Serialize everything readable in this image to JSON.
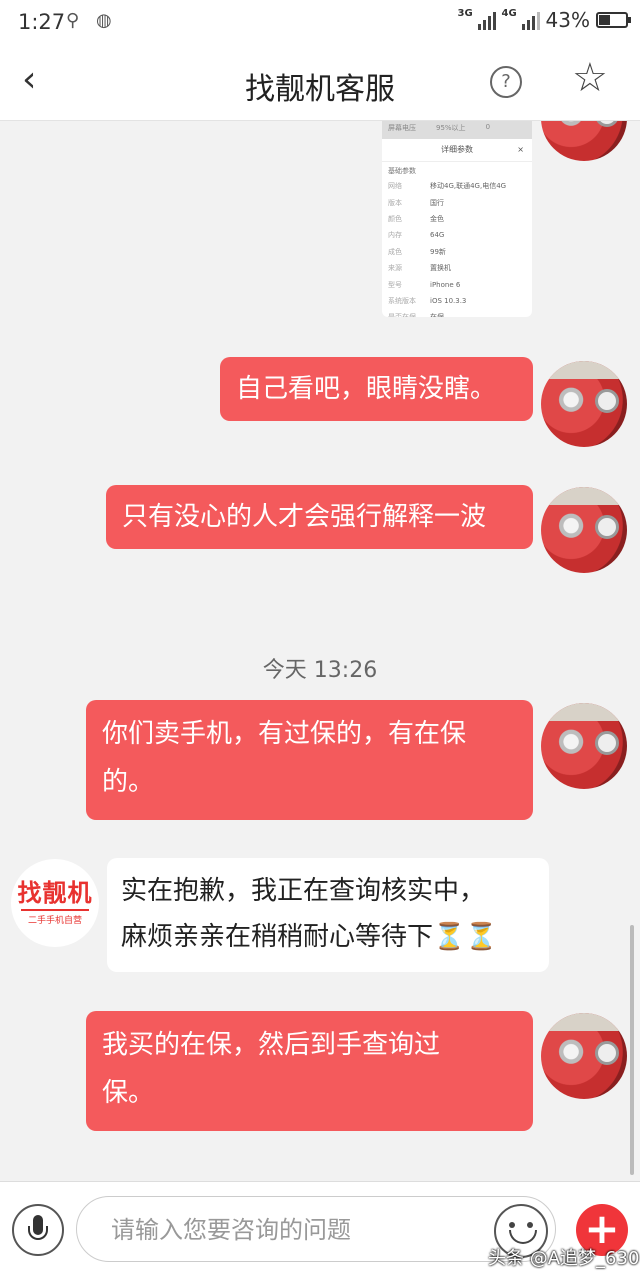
{
  "status": {
    "time": "1:27",
    "battery": "43%",
    "battery_level": 0.43,
    "net1": "3G",
    "net2": "4G"
  },
  "header": {
    "title": "找靓机客服",
    "help_icon": "?",
    "back_icon": "‹",
    "star_icon": "☆"
  },
  "screenshot": {
    "top_left": "屏幕电压",
    "top_right": "95%以上",
    "top_val": "0",
    "title": "详细参数",
    "section": "基础参数",
    "rows": [
      {
        "k": "网络",
        "v": "移动4G,联通4G,电信4G"
      },
      {
        "k": "版本",
        "v": "国行"
      },
      {
        "k": "颜色",
        "v": "金色"
      },
      {
        "k": "内存",
        "v": "64G"
      },
      {
        "k": "成色",
        "v": "99新"
      },
      {
        "k": "来源",
        "v": "置换机"
      },
      {
        "k": "型号",
        "v": "iPhone 6"
      },
      {
        "k": "系统版本",
        "v": "iOS 10.3.3"
      },
      {
        "k": "是否在保",
        "v": "在保"
      }
    ]
  },
  "messages": {
    "m1": "自己看吧，眼睛没瞎。",
    "m2": "只有没心的人才会强行解释一波",
    "timestamp": "今天 13:26",
    "m3_line1": "你们卖手机，有过保的，有在保",
    "m3_line2": "的。",
    "m4_line1": "实在抱歉，我正在查询核实中，",
    "m4_line2": "麻烦亲亲在稍稍耐心等待下⏳⏳",
    "m5_line1": "我买的在保，然后到手查询过",
    "m5_line2": "保。"
  },
  "bot": {
    "logo": "找靓机",
    "sub": "二手手机自营"
  },
  "input": {
    "placeholder": "请输入您要咨询的问题"
  },
  "watermark": "头条 @A追梦_630"
}
